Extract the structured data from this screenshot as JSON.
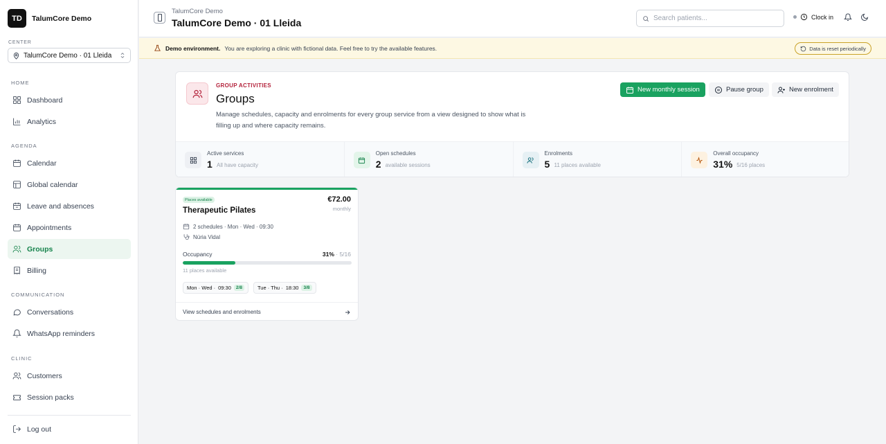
{
  "brand": {
    "initials": "TD",
    "name": "TalumCore Demo"
  },
  "center": {
    "label": "CENTER",
    "value": "TalumCore Demo · 01 Lleida"
  },
  "nav": {
    "home_label": "HOME",
    "agenda_label": "AGENDA",
    "communication_label": "COMMUNICATION",
    "clinic_label": "CLINIC",
    "dashboard": "Dashboard",
    "analytics": "Analytics",
    "calendar": "Calendar",
    "global_calendar": "Global calendar",
    "leave": "Leave and absences",
    "appointments": "Appointments",
    "groups": "Groups",
    "billing": "Billing",
    "conversations": "Conversations",
    "whatsapp": "WhatsApp reminders",
    "customers": "Customers",
    "session_packs": "Session packs",
    "logout": "Log out"
  },
  "header": {
    "breadcrumb": "TalumCore Demo",
    "title": "TalumCore Demo · 01 Lleida",
    "search_placeholder": "Search patients...",
    "clock_in": "Clock in"
  },
  "banner": {
    "strong": "Demo environment.",
    "text": "You are exploring a clinic with fictional data. Feel free to try the available features.",
    "reset": "Data is reset periodically"
  },
  "groups": {
    "eyebrow": "GROUP ACTIVITIES",
    "title": "Groups",
    "description": "Manage schedules, capacity and enrolments for every group service from a view designed to show what is filling up and where capacity remains.",
    "btn_new_session": "New monthly session",
    "btn_pause": "Pause group",
    "btn_new_enrolment": "New enrolment",
    "stats": [
      {
        "label": "Active services",
        "value": "1",
        "sub": "All have capacity"
      },
      {
        "label": "Open schedules",
        "value": "2",
        "sub": "available sessions"
      },
      {
        "label": "Enrolments",
        "value": "5",
        "sub": "11 places available"
      },
      {
        "label": "Overall occupancy",
        "value": "31%",
        "sub": "5/16 places"
      }
    ]
  },
  "service": {
    "badge": "Places available",
    "title": "Therapeutic Pilates",
    "price": "€72.00",
    "period": "monthly",
    "schedules": "2 schedules · Mon · Wed · 09:30",
    "therapist": "Núria Vidal",
    "occupancy_label": "Occupancy",
    "occupancy_pct": "31%",
    "occupancy_ratio": "· 5/16",
    "occupancy_fraction": 0.3125,
    "places_available": "11 places available",
    "slots": [
      {
        "days": "Mon · Wed ·",
        "time": "09:30",
        "count": "2/8"
      },
      {
        "days": "Tue · Thu ·",
        "time": "18:30",
        "count": "3/8"
      }
    ],
    "footer_link": "View schedules and enrolments"
  },
  "colors": {
    "accent_green": "#1aa260",
    "accent_red": "#b4233c",
    "banner_bg": "#fdf8e3"
  }
}
